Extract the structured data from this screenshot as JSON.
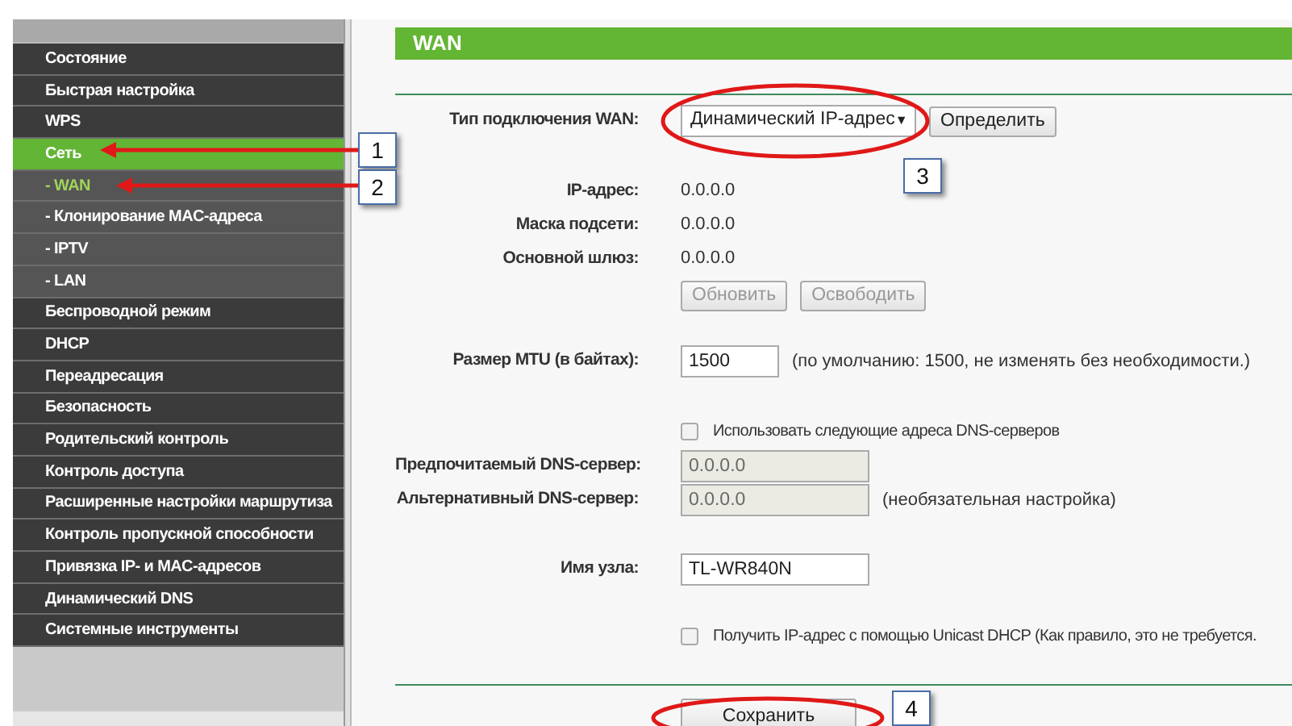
{
  "sidebar": {
    "items": [
      {
        "label": "Состояние",
        "kind": "main",
        "selected": false
      },
      {
        "label": "Быстрая настройка",
        "kind": "main",
        "selected": false
      },
      {
        "label": "WPS",
        "kind": "main",
        "selected": false
      },
      {
        "label": "Сеть",
        "kind": "main",
        "selected": true
      },
      {
        "label": "- WAN",
        "kind": "sub",
        "selected": true
      },
      {
        "label": "- Клонирование MAC-адреса",
        "kind": "sub",
        "selected": false
      },
      {
        "label": "- IPTV",
        "kind": "sub",
        "selected": false
      },
      {
        "label": "- LAN",
        "kind": "sub",
        "selected": false
      },
      {
        "label": "Беспроводной режим",
        "kind": "main",
        "selected": false
      },
      {
        "label": "DHCP",
        "kind": "main",
        "selected": false
      },
      {
        "label": "Переадресация",
        "kind": "main",
        "selected": false
      },
      {
        "label": "Безопасность",
        "kind": "main",
        "selected": false
      },
      {
        "label": "Родительский контроль",
        "kind": "main",
        "selected": false
      },
      {
        "label": "Контроль доступа",
        "kind": "main",
        "selected": false
      },
      {
        "label": "Расширенные настройки маршрутиза",
        "kind": "main",
        "selected": false
      },
      {
        "label": "Контроль пропускной способности",
        "kind": "main",
        "selected": false
      },
      {
        "label": "Привязка IP- и MAC-адресов",
        "kind": "main",
        "selected": false
      },
      {
        "label": "Динамический DNS",
        "kind": "main",
        "selected": false
      },
      {
        "label": "Системные инструменты",
        "kind": "main",
        "selected": false
      }
    ]
  },
  "page_title": "WAN",
  "connection_type": {
    "label": "Тип подключения WAN:",
    "value": "Динамический IP-адрес",
    "caret": "▼",
    "button": "Определить"
  },
  "status": [
    {
      "label": "IP-адрес:",
      "value": "0.0.0.0"
    },
    {
      "label": "Маска подсети:",
      "value": "0.0.0.0"
    },
    {
      "label": "Основной шлюз:",
      "value": "0.0.0.0"
    }
  ],
  "status_buttons": [
    {
      "label": "Обновить",
      "disabled": true
    },
    {
      "label": "Освободить",
      "disabled": true
    }
  ],
  "mtu": {
    "label": "Размер MTU (в байтах):",
    "value": "1500",
    "hint": "(по умолчанию: 1500, не изменять без необходимости.)"
  },
  "dns_checkbox": {
    "label": "Использовать следующие адреса DNS-серверов",
    "checked": false
  },
  "dns": [
    {
      "label": "Предпочитаемый DNS-сервер:",
      "value": "0.0.0.0",
      "disabled": true
    },
    {
      "label": "Альтернативный DNS-сервер:",
      "value": "0.0.0.0",
      "disabled": true,
      "hint": "(необязательная настройка)"
    }
  ],
  "host": {
    "label": "Имя узла:",
    "value": "TL-WR840N"
  },
  "unicast_checkbox": {
    "label": "Получить IP-адрес с помощью Unicast DHCP (Как правило, это не требуется.",
    "checked": false
  },
  "save_button": "Сохранить",
  "annotations": [
    "1",
    "2",
    "3",
    "4"
  ]
}
